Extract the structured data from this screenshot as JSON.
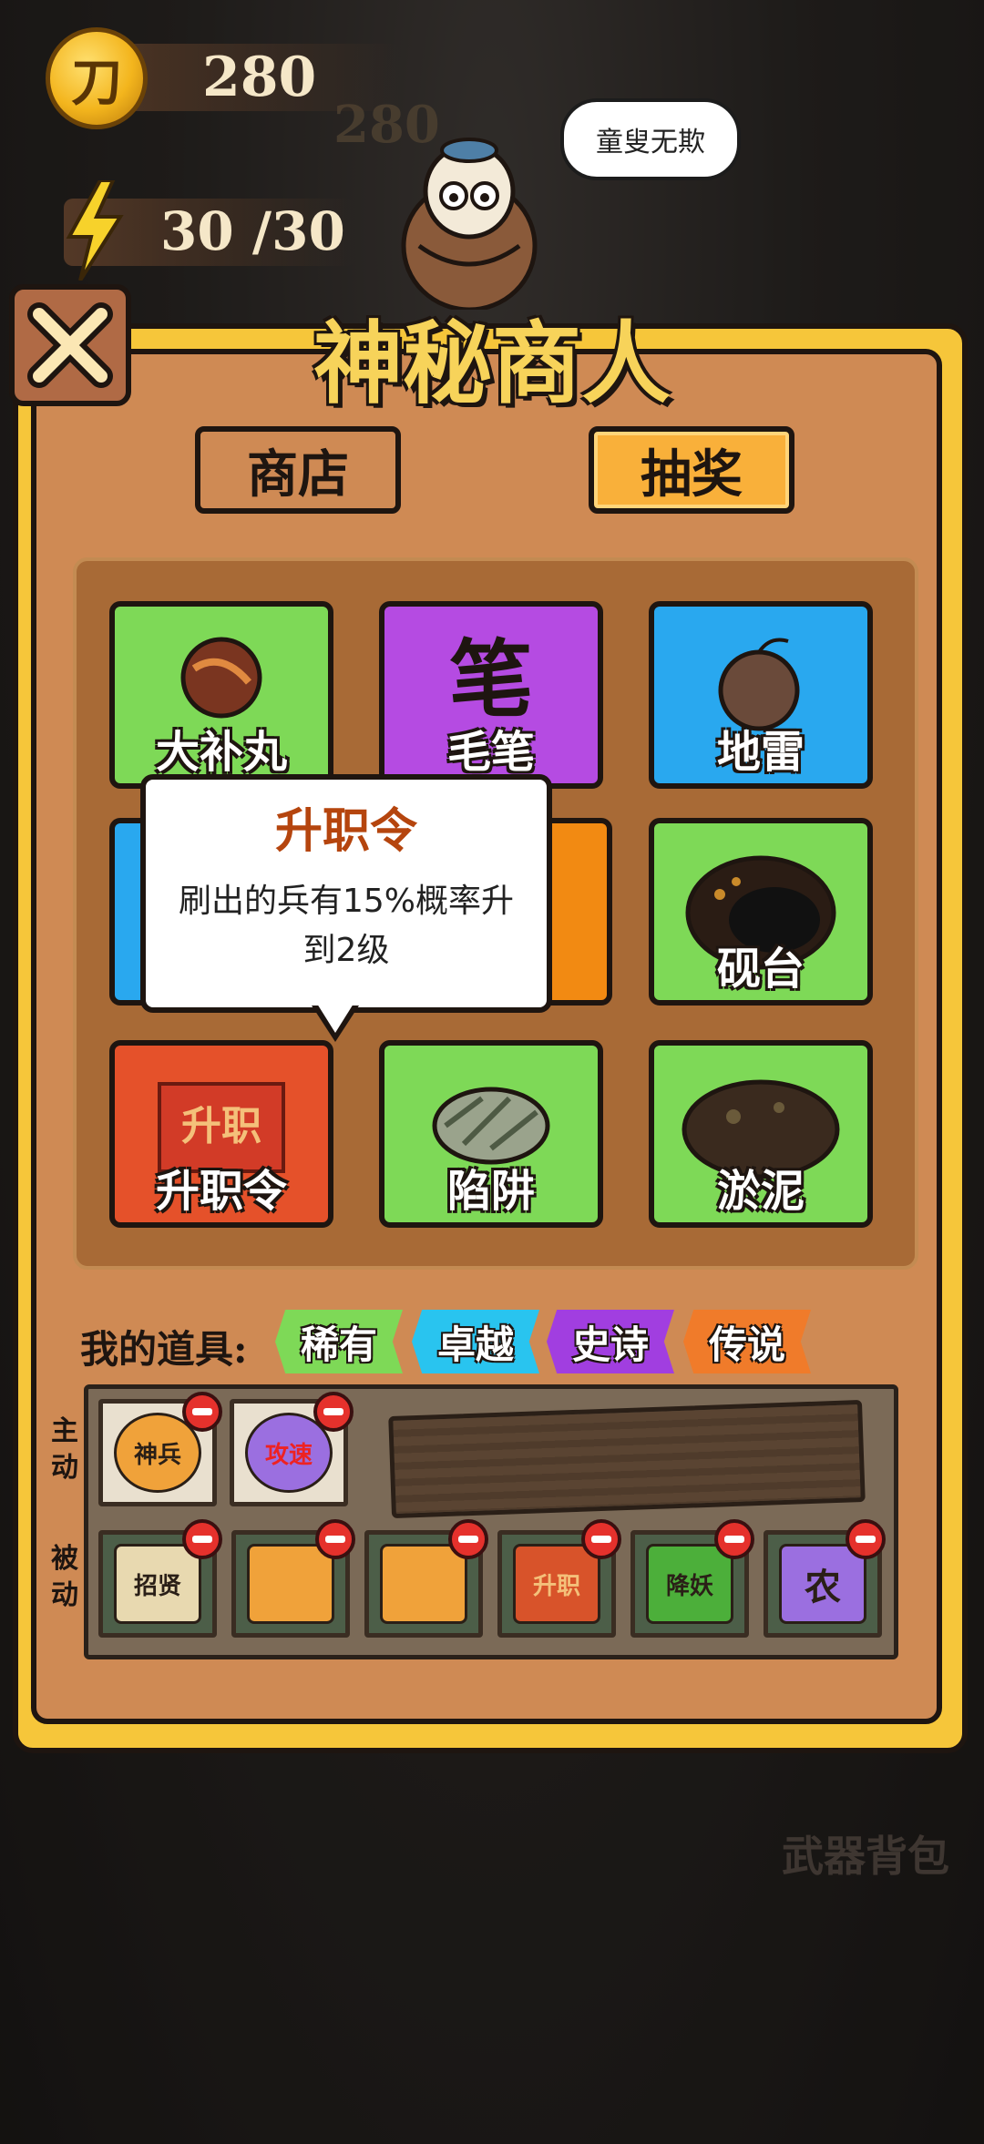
{
  "hud": {
    "coins": "280",
    "coins_ghost": "280",
    "coin_glyph": "刀",
    "energy": "30 /30"
  },
  "merchant": {
    "speech": "童叟无欺"
  },
  "panel": {
    "title": "神秘商人",
    "tabs": [
      "商店",
      "抽奖"
    ],
    "selected_tab": "抽奖"
  },
  "grid": {
    "items": [
      {
        "label": "大补丸",
        "color": "#7ed957"
      },
      {
        "label": "毛笔",
        "color": "#b54be2"
      },
      {
        "label": "地雷",
        "color": "#29a8ef"
      },
      {
        "label": "",
        "color": "#29a8ef"
      },
      {
        "label": "",
        "color": "#f28a12"
      },
      {
        "label": "砚台",
        "color": "#7ed957"
      },
      {
        "label": "升职令",
        "color": "#e5512a"
      },
      {
        "label": "陷阱",
        "color": "#7ed957"
      },
      {
        "label": "淤泥",
        "color": "#7ed957"
      }
    ],
    "brush_glyph": "笔",
    "promotion_art_text": "升职"
  },
  "tooltip": {
    "title": "升职令",
    "desc_line1": "刷出的兵有15%概率升",
    "desc_line2": "到2级"
  },
  "inventory": {
    "title": "我的道具:",
    "rarities": [
      {
        "label": "稀有",
        "color": "#7ed957"
      },
      {
        "label": "卓越",
        "color": "#29c4ef"
      },
      {
        "label": "史诗",
        "color": "#a13ee0"
      },
      {
        "label": "传说",
        "color": "#f07b2a"
      }
    ],
    "active_label": "主动",
    "passive_label": "被动",
    "active_items": [
      {
        "glyph": "神兵",
        "color": "#f0a23a"
      },
      {
        "glyph": "攻速",
        "color": "#9b6fe0"
      }
    ],
    "passive_items": [
      {
        "glyph": "招贤",
        "color": "#e8d9b0"
      },
      {
        "glyph": "",
        "color": "#f0a23a"
      },
      {
        "glyph": "",
        "color": "#f0a23a"
      },
      {
        "glyph": "升职",
        "color": "#d8532a"
      },
      {
        "glyph": "降妖",
        "color": "#4caf3a"
      },
      {
        "glyph": "农",
        "color": "#9b6fe0"
      }
    ]
  },
  "footer": {
    "weapon_bag": "武器背包"
  }
}
